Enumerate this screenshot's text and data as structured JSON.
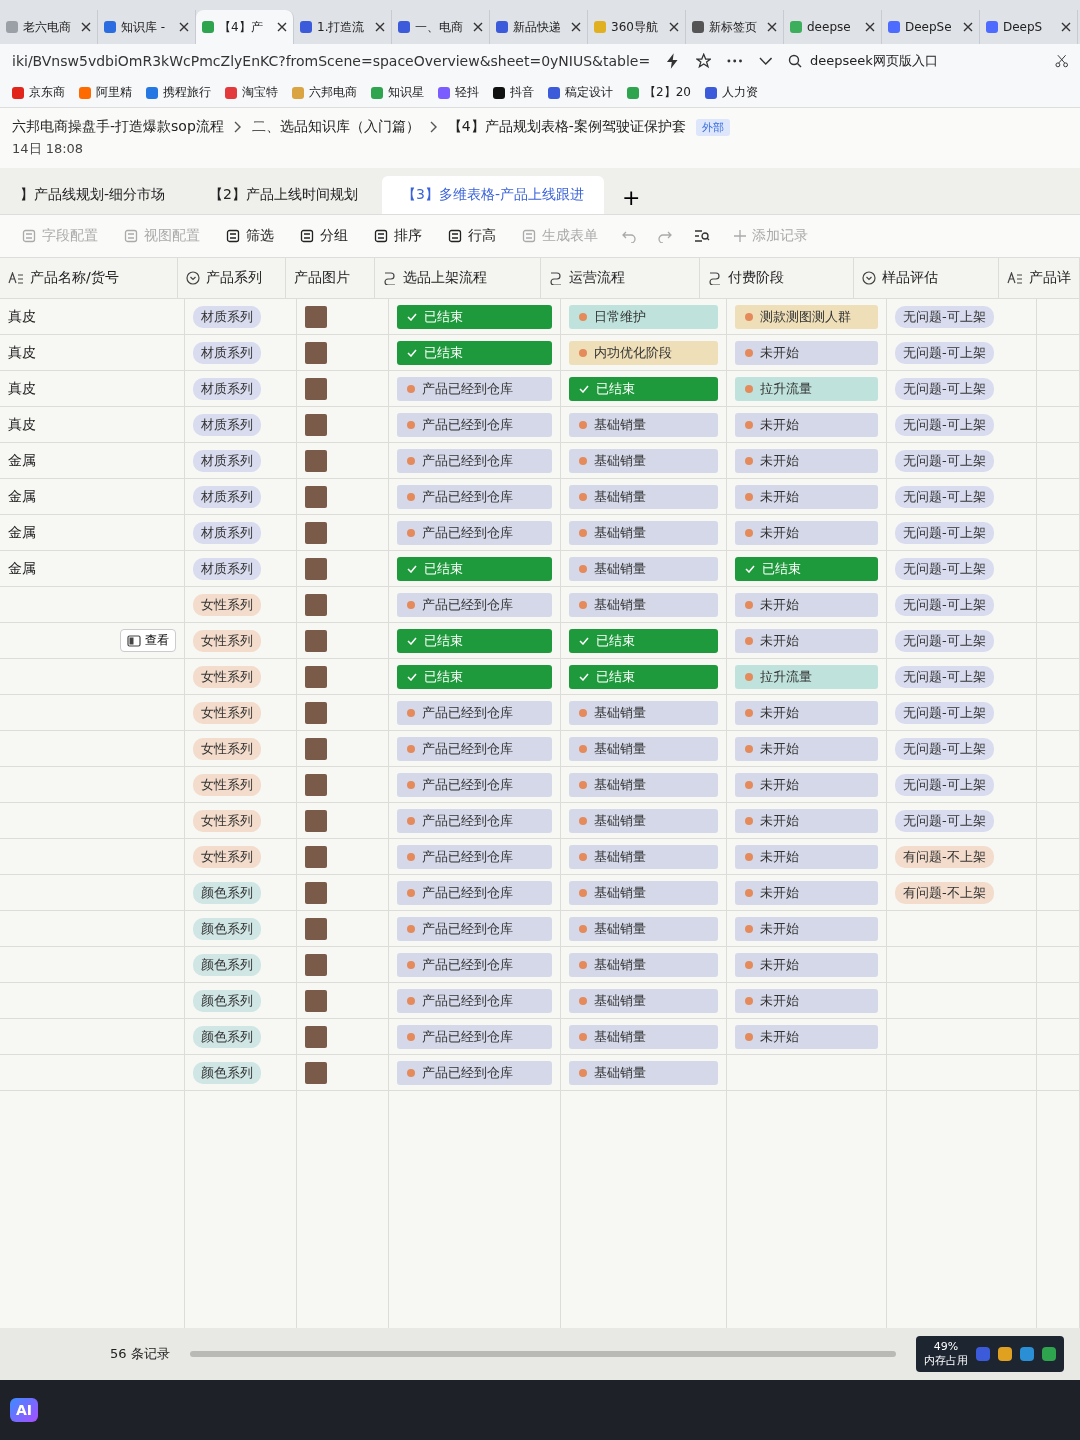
{
  "browser": {
    "tabs": [
      {
        "label": "老六电商",
        "selected": false,
        "color": "#9aa0a6"
      },
      {
        "label": "知识库 -",
        "selected": false,
        "color": "#2b6de0"
      },
      {
        "label": "【4】产",
        "selected": true,
        "color": "#2ea44f"
      },
      {
        "label": "1.打造流",
        "selected": false,
        "color": "#3b5bdb"
      },
      {
        "label": "一、电商",
        "selected": false,
        "color": "#3b5bdb"
      },
      {
        "label": "新品快递",
        "selected": false,
        "color": "#3b5bdb"
      },
      {
        "label": "360导航",
        "selected": false,
        "color": "#e0b020"
      },
      {
        "label": "新标签页",
        "selected": false,
        "color": "#555555"
      },
      {
        "label": "deepse",
        "selected": false,
        "color": "#3cae5c"
      },
      {
        "label": "DeepSe",
        "selected": false,
        "color": "#4d6bfe"
      },
      {
        "label": "DeepS",
        "selected": false,
        "color": "#4d6bfe"
      }
    ],
    "address": "iki/BVnsw5vdbiOmR3kWcPmcZlyEnKC?fromScene=spaceOverview&sheet=0yNIUS&table=",
    "search": "deepseek网页版入口",
    "bookmarks": [
      {
        "label": "京东商",
        "color": "#e1251b"
      },
      {
        "label": "阿里精",
        "color": "#ff6a00"
      },
      {
        "label": "携程旅行",
        "color": "#2577e3"
      },
      {
        "label": "淘宝特",
        "color": "#e4393c"
      },
      {
        "label": "六邦电商",
        "color": "#d9a441"
      },
      {
        "label": "知识星",
        "color": "#2ea44f"
      },
      {
        "label": "轻抖",
        "color": "#7b5cff"
      },
      {
        "label": "抖音",
        "color": "#111111"
      },
      {
        "label": "稿定设计",
        "color": "#3b5bdb"
      },
      {
        "label": "【2】20",
        "color": "#2ea44f"
      },
      {
        "label": "人力资",
        "color": "#3b5bdb"
      }
    ]
  },
  "breadcrumb": [
    "六邦电商操盘手-打造爆款sop流程",
    "二、选品知识库（入门篇）",
    "【4】产品规划表格-案例驾驶证保护套"
  ],
  "external_badge": "外部",
  "updated": "14日 18:08",
  "sheet_tabs": [
    {
      "label": "】产品线规划-细分市场",
      "selected": false
    },
    {
      "label": "【2】产品上线时间规划",
      "selected": false
    },
    {
      "label": "【3】多维表格-产品上线跟进",
      "selected": true
    }
  ],
  "add_sheet": "+",
  "toolbar": [
    {
      "label": "字段配置",
      "disabled": true
    },
    {
      "label": "视图配置",
      "disabled": true
    },
    {
      "label": "筛选",
      "disabled": false
    },
    {
      "label": "分组",
      "disabled": false
    },
    {
      "label": "排序",
      "disabled": false
    },
    {
      "label": "行高",
      "disabled": false
    },
    {
      "label": "生成表单",
      "disabled": true
    }
  ],
  "add_record": "添加记录",
  "columns": [
    {
      "label": "产品名称/货号",
      "kind": "text"
    },
    {
      "label": "产品系列",
      "kind": "select"
    },
    {
      "label": "产品图片",
      "kind": "image"
    },
    {
      "label": "选品上架流程",
      "kind": "flow"
    },
    {
      "label": "运营流程",
      "kind": "flow"
    },
    {
      "label": "付费阶段",
      "kind": "flow"
    },
    {
      "label": "样品评估",
      "kind": "select"
    },
    {
      "label": "产品详",
      "kind": "text"
    }
  ],
  "rows": [
    {
      "name": "真皮",
      "series": {
        "label": "材质系列",
        "color": "#d9dcef"
      },
      "listing": {
        "label": "已结束",
        "kind": "done",
        "color": "#1e9a3c"
      },
      "ops": {
        "label": "日常维护",
        "kind": "pending",
        "color": "#bfe3dc"
      },
      "paid": {
        "label": "测款测图测人群",
        "kind": "pending",
        "color": "#eedfb8"
      },
      "eval": {
        "label": "无问题-可上架",
        "color": "#d9dcef"
      }
    },
    {
      "name": "真皮",
      "series": {
        "label": "材质系列",
        "color": "#d9dcef"
      },
      "listing": {
        "label": "已结束",
        "kind": "done",
        "color": "#1e9a3c"
      },
      "ops": {
        "label": "内功优化阶段",
        "kind": "pending",
        "color": "#eedfb8"
      },
      "paid": {
        "label": "未开始",
        "kind": "pending",
        "color": "#d5d8e8"
      },
      "eval": {
        "label": "无问题-可上架",
        "color": "#d9dcef"
      }
    },
    {
      "name": "真皮",
      "series": {
        "label": "材质系列",
        "color": "#d9dcef"
      },
      "listing": {
        "label": "产品已经到仓库",
        "kind": "pending",
        "color": "#d5d8e8"
      },
      "ops": {
        "label": "已结束",
        "kind": "done",
        "color": "#1e9a3c"
      },
      "paid": {
        "label": "拉升流量",
        "kind": "pending",
        "color": "#bfe3dc"
      },
      "eval": {
        "label": "无问题-可上架",
        "color": "#d9dcef"
      }
    },
    {
      "name": "真皮",
      "series": {
        "label": "材质系列",
        "color": "#d9dcef"
      },
      "listing": {
        "label": "产品已经到仓库",
        "kind": "pending",
        "color": "#d5d8e8"
      },
      "ops": {
        "label": "基础销量",
        "kind": "pending",
        "color": "#d5d8e8"
      },
      "paid": {
        "label": "未开始",
        "kind": "pending",
        "color": "#d5d8e8"
      },
      "eval": {
        "label": "无问题-可上架",
        "color": "#d9dcef"
      }
    },
    {
      "name": "金属",
      "series": {
        "label": "材质系列",
        "color": "#d9dcef"
      },
      "listing": {
        "label": "产品已经到仓库",
        "kind": "pending",
        "color": "#d5d8e8"
      },
      "ops": {
        "label": "基础销量",
        "kind": "pending",
        "color": "#d5d8e8"
      },
      "paid": {
        "label": "未开始",
        "kind": "pending",
        "color": "#d5d8e8"
      },
      "eval": {
        "label": "无问题-可上架",
        "color": "#d9dcef"
      }
    },
    {
      "name": "金属",
      "series": {
        "label": "材质系列",
        "color": "#d9dcef"
      },
      "listing": {
        "label": "产品已经到仓库",
        "kind": "pending",
        "color": "#d5d8e8"
      },
      "ops": {
        "label": "基础销量",
        "kind": "pending",
        "color": "#d5d8e8"
      },
      "paid": {
        "label": "未开始",
        "kind": "pending",
        "color": "#d5d8e8"
      },
      "eval": {
        "label": "无问题-可上架",
        "color": "#d9dcef"
      }
    },
    {
      "name": "金属",
      "series": {
        "label": "材质系列",
        "color": "#d9dcef"
      },
      "listing": {
        "label": "产品已经到仓库",
        "kind": "pending",
        "color": "#d5d8e8"
      },
      "ops": {
        "label": "基础销量",
        "kind": "pending",
        "color": "#d5d8e8"
      },
      "paid": {
        "label": "未开始",
        "kind": "pending",
        "color": "#d5d8e8"
      },
      "eval": {
        "label": "无问题-可上架",
        "color": "#d9dcef"
      }
    },
    {
      "name": "金属",
      "series": {
        "label": "材质系列",
        "color": "#d9dcef"
      },
      "listing": {
        "label": "已结束",
        "kind": "done",
        "color": "#1e9a3c"
      },
      "ops": {
        "label": "基础销量",
        "kind": "pending",
        "color": "#d5d8e8"
      },
      "paid": {
        "label": "已结束",
        "kind": "done",
        "color": "#1e9a3c"
      },
      "eval": {
        "label": "无问题-可上架",
        "color": "#d9dcef"
      }
    },
    {
      "series": {
        "label": "女性系列",
        "color": "#f3dccb"
      },
      "listing": {
        "label": "产品已经到仓库",
        "kind": "pending",
        "color": "#d5d8e8"
      },
      "ops": {
        "label": "基础销量",
        "kind": "pending",
        "color": "#d5d8e8"
      },
      "paid": {
        "label": "未开始",
        "kind": "pending",
        "color": "#d5d8e8"
      },
      "eval": {
        "label": "无问题-可上架",
        "color": "#d9dcef"
      }
    },
    {
      "view_button": "查看",
      "series": {
        "label": "女性系列",
        "color": "#f3dccb"
      },
      "listing": {
        "label": "已结束",
        "kind": "done",
        "color": "#1e9a3c"
      },
      "ops": {
        "label": "已结束",
        "kind": "done",
        "color": "#1e9a3c"
      },
      "paid": {
        "label": "未开始",
        "kind": "pending",
        "color": "#d5d8e8"
      },
      "eval": {
        "label": "无问题-可上架",
        "color": "#d9dcef"
      }
    },
    {
      "series": {
        "label": "女性系列",
        "color": "#f3dccb"
      },
      "listing": {
        "label": "已结束",
        "kind": "done",
        "color": "#1e9a3c"
      },
      "ops": {
        "label": "已结束",
        "kind": "done",
        "color": "#1e9a3c"
      },
      "paid": {
        "label": "拉升流量",
        "kind": "pending",
        "color": "#bfe3dc"
      },
      "eval": {
        "label": "无问题-可上架",
        "color": "#d9dcef"
      }
    },
    {
      "series": {
        "label": "女性系列",
        "color": "#f3dccb"
      },
      "listing": {
        "label": "产品已经到仓库",
        "kind": "pending",
        "color": "#d5d8e8"
      },
      "ops": {
        "label": "基础销量",
        "kind": "pending",
        "color": "#d5d8e8"
      },
      "paid": {
        "label": "未开始",
        "kind": "pending",
        "color": "#d5d8e8"
      },
      "eval": {
        "label": "无问题-可上架",
        "color": "#d9dcef"
      }
    },
    {
      "series": {
        "label": "女性系列",
        "color": "#f3dccb"
      },
      "listing": {
        "label": "产品已经到仓库",
        "kind": "pending",
        "color": "#d5d8e8"
      },
      "ops": {
        "label": "基础销量",
        "kind": "pending",
        "color": "#d5d8e8"
      },
      "paid": {
        "label": "未开始",
        "kind": "pending",
        "color": "#d5d8e8"
      },
      "eval": {
        "label": "无问题-可上架",
        "color": "#d9dcef"
      }
    },
    {
      "series": {
        "label": "女性系列",
        "color": "#f3dccb"
      },
      "listing": {
        "label": "产品已经到仓库",
        "kind": "pending",
        "color": "#d5d8e8"
      },
      "ops": {
        "label": "基础销量",
        "kind": "pending",
        "color": "#d5d8e8"
      },
      "paid": {
        "label": "未开始",
        "kind": "pending",
        "color": "#d5d8e8"
      },
      "eval": {
        "label": "无问题-可上架",
        "color": "#d9dcef"
      }
    },
    {
      "series": {
        "label": "女性系列",
        "color": "#f3dccb"
      },
      "listing": {
        "label": "产品已经到仓库",
        "kind": "pending",
        "color": "#d5d8e8"
      },
      "ops": {
        "label": "基础销量",
        "kind": "pending",
        "color": "#d5d8e8"
      },
      "paid": {
        "label": "未开始",
        "kind": "pending",
        "color": "#d5d8e8"
      },
      "eval": {
        "label": "无问题-可上架",
        "color": "#d9dcef"
      }
    },
    {
      "series": {
        "label": "女性系列",
        "color": "#f3dccb"
      },
      "listing": {
        "label": "产品已经到仓库",
        "kind": "pending",
        "color": "#d5d8e8"
      },
      "ops": {
        "label": "基础销量",
        "kind": "pending",
        "color": "#d5d8e8"
      },
      "paid": {
        "label": "未开始",
        "kind": "pending",
        "color": "#d5d8e8"
      },
      "eval": {
        "label": "有问题-不上架",
        "color": "#f3dccb"
      }
    },
    {
      "series": {
        "label": "颜色系列",
        "color": "#cfe6e4"
      },
      "listing": {
        "label": "产品已经到仓库",
        "kind": "pending",
        "color": "#d5d8e8"
      },
      "ops": {
        "label": "基础销量",
        "kind": "pending",
        "color": "#d5d8e8"
      },
      "paid": {
        "label": "未开始",
        "kind": "pending",
        "color": "#d5d8e8"
      },
      "eval": {
        "label": "有问题-不上架",
        "color": "#f3dccb"
      }
    },
    {
      "series": {
        "label": "颜色系列",
        "color": "#cfe6e4"
      },
      "listing": {
        "label": "产品已经到仓库",
        "kind": "pending",
        "color": "#d5d8e8"
      },
      "ops": {
        "label": "基础销量",
        "kind": "pending",
        "color": "#d5d8e8"
      },
      "paid": {
        "label": "未开始",
        "kind": "pending",
        "color": "#d5d8e8"
      }
    },
    {
      "series": {
        "label": "颜色系列",
        "color": "#cfe6e4"
      },
      "listing": {
        "label": "产品已经到仓库",
        "kind": "pending",
        "color": "#d5d8e8"
      },
      "ops": {
        "label": "基础销量",
        "kind": "pending",
        "color": "#d5d8e8"
      },
      "paid": {
        "label": "未开始",
        "kind": "pending",
        "color": "#d5d8e8"
      }
    },
    {
      "series": {
        "label": "颜色系列",
        "color": "#cfe6e4"
      },
      "listing": {
        "label": "产品已经到仓库",
        "kind": "pending",
        "color": "#d5d8e8"
      },
      "ops": {
        "label": "基础销量",
        "kind": "pending",
        "color": "#d5d8e8"
      },
      "paid": {
        "label": "未开始",
        "kind": "pending",
        "color": "#d5d8e8"
      }
    },
    {
      "series": {
        "label": "颜色系列",
        "color": "#cfe6e4"
      },
      "listing": {
        "label": "产品已经到仓库",
        "kind": "pending",
        "color": "#d5d8e8"
      },
      "ops": {
        "label": "基础销量",
        "kind": "pending",
        "color": "#d5d8e8"
      },
      "paid": {
        "label": "未开始",
        "kind": "pending",
        "color": "#d5d8e8"
      }
    },
    {
      "series": {
        "label": "颜色系列",
        "color": "#cfe6e4"
      },
      "listing": {
        "label": "产品已经到仓库",
        "kind": "pending",
        "color": "#d5d8e8"
      },
      "ops": {
        "label": "基础销量",
        "kind": "pending",
        "color": "#d5d8e8"
      }
    }
  ],
  "record_count": "56 条记录",
  "taskbar": {
    "memory_percent": "49%",
    "memory_label": "内存占用",
    "start": "AI"
  }
}
